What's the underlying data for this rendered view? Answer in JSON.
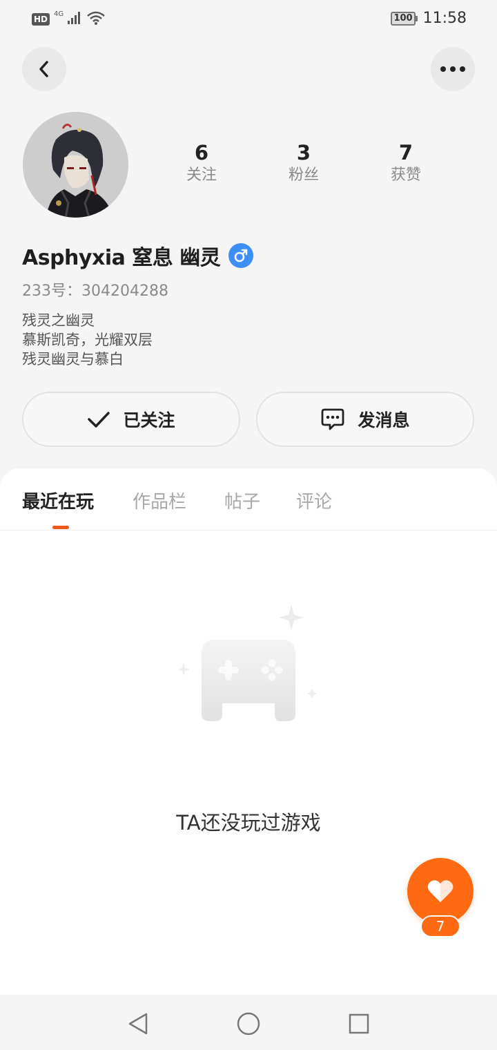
{
  "status_bar": {
    "hd": "HD",
    "network": "4G",
    "battery": "100",
    "time": "11:58"
  },
  "profile": {
    "name": "Asphyxia 窒息 幽灵",
    "gender": "male",
    "id_text": "233号：304204288",
    "bio_lines": [
      "残灵之幽灵",
      "慕斯凯奇，光耀双层",
      "残灵幽灵与慕白"
    ],
    "stats": [
      {
        "value": "6",
        "label": "关注"
      },
      {
        "value": "3",
        "label": "粉丝"
      },
      {
        "value": "7",
        "label": "获赞"
      }
    ]
  },
  "actions": {
    "follow_label": "已关注",
    "message_label": "发消息"
  },
  "tabs": [
    {
      "label": "最近在玩",
      "active": true
    },
    {
      "label": "作品栏",
      "active": false
    },
    {
      "label": "帖子",
      "active": false
    },
    {
      "label": "评论",
      "active": false
    }
  ],
  "empty_state": {
    "text": "TA还没玩过游戏",
    "icon": "gamepad-icon"
  },
  "like": {
    "count": "7"
  },
  "colors": {
    "accent": "#ff6a13",
    "gender_male": "#3e8ef7",
    "tab_indicator": "#f0571d"
  }
}
